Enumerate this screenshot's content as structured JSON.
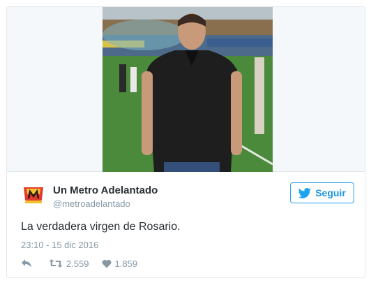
{
  "tweet": {
    "author_name": "Un Metro Adelantado",
    "author_handle": "@metroadelantado",
    "follow_label": "Seguir",
    "text": "La verdadera virgen de Rosario.",
    "timestamp": "23:10 - 15 dic 2016",
    "retweet_count": "2.559",
    "like_count": "1.859"
  },
  "icons": {
    "follow": "twitter-bird-icon",
    "reply": "reply-icon",
    "retweet": "retweet-icon",
    "like": "heart-icon"
  },
  "colors": {
    "accent": "#1da1f2",
    "muted": "#8899a6",
    "text": "#292f33",
    "border": "#e1e8ed"
  }
}
